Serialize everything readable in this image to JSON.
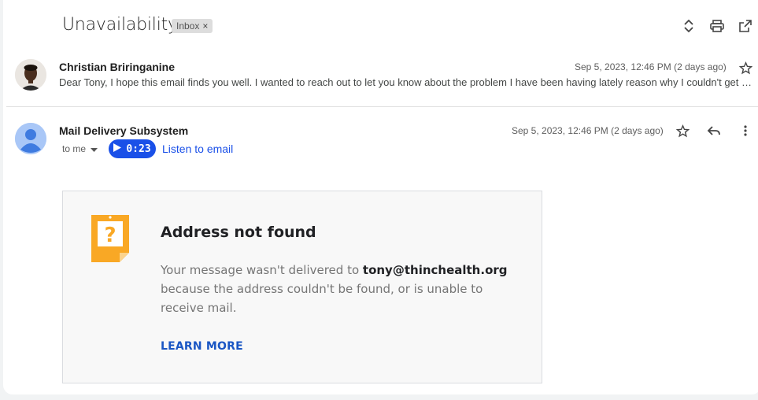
{
  "thread": {
    "subject": "Unavailability",
    "label": "Inbox",
    "label_remove": "×"
  },
  "toolbar_icons": [
    "expand-collapse-icon",
    "print-icon",
    "open-in-new-window-icon"
  ],
  "messages": [
    {
      "sender": "Christian Briringanine",
      "date": "Sep 5, 2023, 12:46 PM (2 days ago)",
      "snippet": "Dear Tony, I hope this email finds you well. I wanted to reach out to let you know about the problem I have been having lately reason why I couldn't get …",
      "avatar": "photo"
    },
    {
      "sender": "Mail Delivery Subsystem",
      "date": "Sep 5, 2023, 12:46 PM (2 days ago)",
      "recipient": "to me",
      "audio_duration": "0:23",
      "listen_label": "Listen to email",
      "avatar": "default-person"
    }
  ],
  "bounce": {
    "title": "Address not found",
    "body_prefix": "Your message wasn't delivered to ",
    "address": "tony@thinchealth.org",
    "body_suffix": " because the address couldn't be found, or is unable to receive mail.",
    "learn_more": "LEARN MORE"
  },
  "colors": {
    "accent": "#1a50e8",
    "link": "#1a56c4",
    "bounce_icon": "#f9a825"
  }
}
